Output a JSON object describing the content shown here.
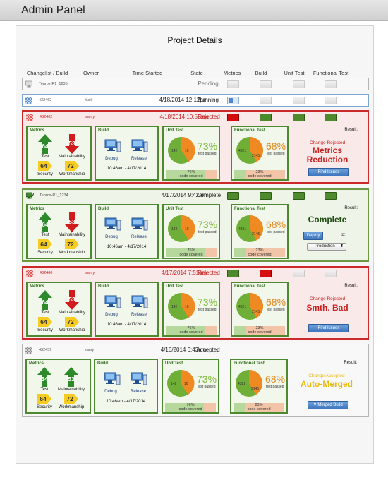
{
  "app": {
    "title": "Admin Panel"
  },
  "page": {
    "title": "Project Details"
  },
  "columns": [
    "Changelist / Build",
    "Owner",
    "Time Started",
    "State",
    "Metrics",
    "Build",
    "Unit Test",
    "Functional Test"
  ],
  "rows": [
    {
      "changelist": "Tenrox-R1_1235",
      "owner": "",
      "time": "",
      "state": "Pending"
    },
    {
      "changelist": "432462",
      "owner": "jtuck",
      "time": "4/18/2014 12:12pm",
      "state": "Running"
    },
    {
      "changelist": "432462",
      "owner": "samy",
      "time": "4/18/2014 10:53am",
      "state": "Rejected",
      "metrics": {
        "test": "64",
        "maintainability": "53",
        "security": "64",
        "workmanship": "72"
      },
      "build": {
        "debug": "Debug",
        "release": "Release",
        "time": "10:46am - 4/17/2014"
      },
      "unit_test": {
        "passed": "142",
        "failed": "10",
        "percent": "73%",
        "sub": "test passed",
        "coverage_pct": "76%",
        "coverage_label": "code covered",
        "coverage_value": 76
      },
      "functional_test": {
        "passed": "4321",
        "failed": "2145",
        "percent": "68%",
        "sub": "test passed",
        "coverage_pct": "23%",
        "coverage_label": "code covered",
        "coverage_value": 23
      },
      "result": {
        "label": "Result:",
        "sub": "Change Rejected",
        "main_line1": "Metrics",
        "main_line2": "Reduction",
        "button": "Find Issues"
      }
    },
    {
      "changelist": "Tenrox-R1_1234",
      "owner": "",
      "time": "4/17/2014 9:42am",
      "state": "Complete",
      "metrics": {
        "test": "64",
        "maintainability": "53",
        "security": "64",
        "workmanship": "72"
      },
      "build": {
        "debug": "Debug",
        "release": "Release",
        "time": "10:46am - 4/17/2014"
      },
      "unit_test": {
        "passed": "142",
        "failed": "10",
        "percent": "73%",
        "sub": "test passed",
        "coverage_pct": "76%",
        "coverage_label": "code covered",
        "coverage_value": 76
      },
      "functional_test": {
        "passed": "4321",
        "failed": "2145",
        "percent": "68%",
        "sub": "test passed",
        "coverage_pct": "23%",
        "coverage_label": "code covered",
        "coverage_value": 23
      },
      "result": {
        "label": "Result:",
        "main_line1": "Complete",
        "button": "Deploy",
        "to_label": "to:",
        "select_value": "Production"
      }
    },
    {
      "changelist": "432460",
      "owner": "samy",
      "time": "4/17/2014 7:51am",
      "state": "Rejected",
      "metrics": {
        "test": "64",
        "maintainability": "53",
        "security": "64",
        "workmanship": "72"
      },
      "build": {
        "debug": "Debug",
        "release": "Release",
        "time": "10:46am - 4/17/2014"
      },
      "unit_test": {
        "passed": "142",
        "failed": "10",
        "percent": "73%",
        "sub": "test passed",
        "coverage_pct": "76%",
        "coverage_label": "code covered",
        "coverage_value": 76
      },
      "functional_test": {
        "passed": "4321",
        "failed": "2145",
        "percent": "68%",
        "sub": "test passed",
        "coverage_pct": "23%",
        "coverage_label": "code covered",
        "coverage_value": 23
      },
      "result": {
        "label": "Result:",
        "sub": "Change Rejected",
        "main_line1": "Smth. Bad",
        "button": "Find Issues"
      }
    },
    {
      "changelist": "432459",
      "owner": "samy",
      "time": "4/16/2014 6:43am",
      "state": "Accepted",
      "metrics": {
        "test": "64",
        "maintainability": "53",
        "security": "64",
        "workmanship": "72"
      },
      "build": {
        "debug": "Debug",
        "release": "Release",
        "time": "10:46am - 4/17/2014"
      },
      "unit_test": {
        "passed": "142",
        "failed": "10",
        "percent": "73%",
        "sub": "test passed",
        "coverage_pct": "76%",
        "coverage_label": "code covered",
        "coverage_value": 76
      },
      "functional_test": {
        "passed": "4321",
        "failed": "2145",
        "percent": "68%",
        "sub": "test passed",
        "coverage_pct": "23%",
        "coverage_label": "code covered",
        "coverage_value": 23
      },
      "result": {
        "label": "Result:",
        "sub": "Change Accepted",
        "main_line1": "Auto-Merged",
        "button": "Merged Build"
      }
    }
  ],
  "labels": {
    "metrics": "Metrics",
    "build": "Build",
    "unit_test": "Unit Test",
    "functional_test": "Functional Test",
    "test": "Test",
    "maintainability": "Maintainability",
    "security": "Security",
    "workmanship": "Workmanship"
  },
  "colors": {
    "reject": "#cc2a2a",
    "accept": "#6c9a42",
    "accent": "#3f76bd",
    "pass": "#7eb93a",
    "fail": "#e0881e",
    "auto_merged": "#e8b80c"
  },
  "icons": {
    "row_pending": "monitor-icon",
    "row_running": "checker-icon",
    "row_rejected": "checker-icon",
    "row_complete": "monitor-check-icon",
    "row_accepted": "checker-icon",
    "merged_button": "magnifier-icon"
  }
}
